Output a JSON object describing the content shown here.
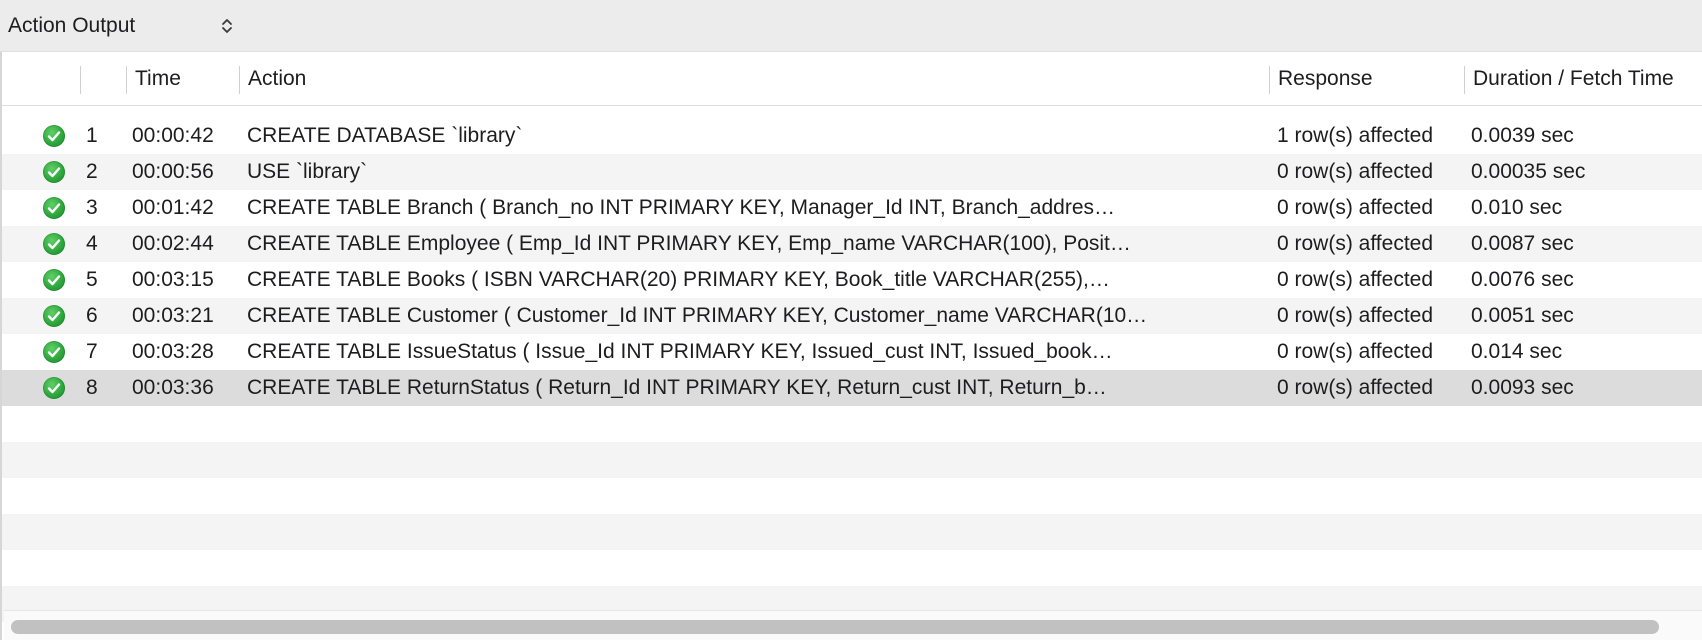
{
  "header": {
    "selector_label": "Action Output",
    "selector_icon": "chevron-up-down-icon"
  },
  "table": {
    "columns": {
      "status": "",
      "num": "",
      "time": "Time",
      "action": "Action",
      "response": "Response",
      "duration": "Duration / Fetch Time"
    },
    "rows": [
      {
        "num": "1",
        "time": "00:00:42",
        "action": "CREATE DATABASE `library`",
        "response": "1 row(s) affected",
        "duration": "0.0039 sec"
      },
      {
        "num": "2",
        "time": "00:00:56",
        "action": "USE `library`",
        "response": "0 row(s) affected",
        "duration": "0.00035 sec"
      },
      {
        "num": "3",
        "time": "00:01:42",
        "action": "CREATE TABLE Branch (     Branch_no INT PRIMARY KEY,     Manager_Id INT,     Branch_addres…",
        "response": "0 row(s) affected",
        "duration": "0.010 sec"
      },
      {
        "num": "4",
        "time": "00:02:44",
        "action": "CREATE TABLE Employee (     Emp_Id INT PRIMARY KEY,     Emp_name VARCHAR(100),     Posit…",
        "response": "0 row(s) affected",
        "duration": "0.0087 sec"
      },
      {
        "num": "5",
        "time": "00:03:15",
        "action": "CREATE TABLE Books (     ISBN VARCHAR(20) PRIMARY KEY,     Book_title VARCHAR(255),…",
        "response": "0 row(s) affected",
        "duration": "0.0076 sec"
      },
      {
        "num": "6",
        "time": "00:03:21",
        "action": "CREATE TABLE Customer (     Customer_Id INT PRIMARY KEY,     Customer_name VARCHAR(10…",
        "response": "0 row(s) affected",
        "duration": "0.0051 sec"
      },
      {
        "num": "7",
        "time": "00:03:28",
        "action": "CREATE TABLE IssueStatus (     Issue_Id INT PRIMARY KEY,     Issued_cust INT,     Issued_book…",
        "response": "0 row(s) affected",
        "duration": "0.014 sec"
      },
      {
        "num": "8",
        "time": "00:03:36",
        "action": "CREATE TABLE ReturnStatus (     Return_Id INT PRIMARY KEY,     Return_cust INT,     Return_b…",
        "response": "0 row(s) affected",
        "duration": "0.0093 sec"
      }
    ],
    "selected_row_index": 7,
    "status_icon": "success-check-icon",
    "colors": {
      "success": "#2aa33a",
      "selected_row": "#dcdcdc",
      "alt_row": "#f4f4f4"
    }
  }
}
